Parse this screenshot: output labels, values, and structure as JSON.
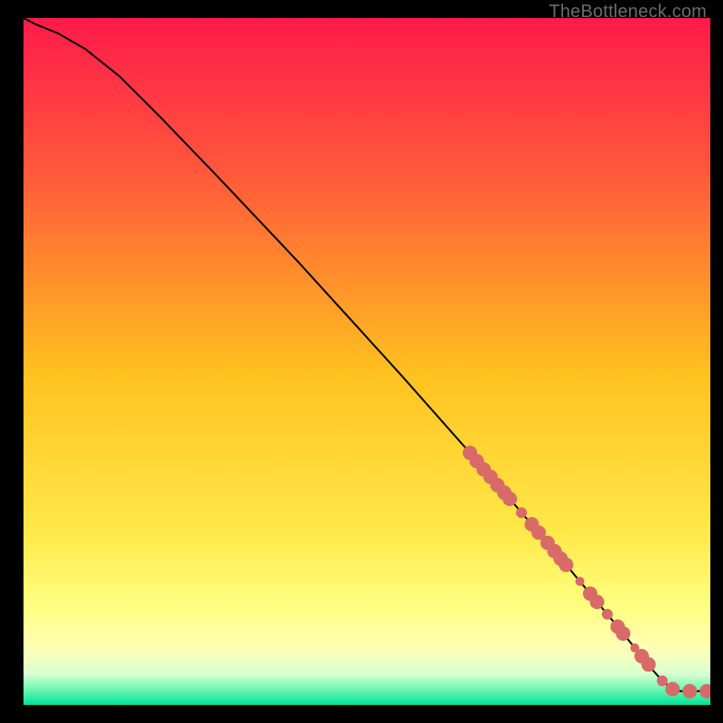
{
  "watermark": "TheBottleneck.com",
  "colors": {
    "background": "#000000",
    "curve": "#000000",
    "marker_fill": "#d86a68",
    "marker_stroke": "#b24c4c"
  },
  "chart_data": {
    "type": "line",
    "title": "",
    "xlabel": "",
    "ylabel": "",
    "xlim": [
      0,
      100
    ],
    "ylim": [
      0,
      100
    ],
    "grid": false,
    "legend": false,
    "gradient_stops": [
      {
        "offset": 0.0,
        "color": "#ff1a4b"
      },
      {
        "offset": 0.23,
        "color": "#ff5a3a"
      },
      {
        "offset": 0.52,
        "color": "#ffc21f"
      },
      {
        "offset": 0.75,
        "color": "#ffe94a"
      },
      {
        "offset": 0.86,
        "color": "#ffff83"
      },
      {
        "offset": 0.92,
        "color": "#fdffb7"
      },
      {
        "offset": 0.955,
        "color": "#d7ffd0"
      },
      {
        "offset": 0.975,
        "color": "#79f7b6"
      },
      {
        "offset": 1.0,
        "color": "#00e598"
      }
    ],
    "series": [
      {
        "name": "bottleneck-curve",
        "x": [
          0.0,
          2.0,
          5.0,
          9.0,
          14.0,
          20.0,
          28.0,
          40.0,
          55.0,
          65.0,
          72.0,
          78.0,
          82.0,
          86.0,
          89.0,
          91.5,
          93.2,
          95.0,
          97.5,
          100.0
        ],
        "y": [
          100.0,
          99.0,
          97.8,
          95.5,
          91.5,
          85.5,
          77.2,
          64.5,
          48.0,
          36.7,
          28.6,
          21.6,
          16.8,
          12.0,
          8.3,
          5.2,
          3.3,
          2.0,
          2.0,
          2.0
        ]
      }
    ],
    "markers": {
      "name": "highlight-points",
      "x": [
        65.0,
        66.0,
        67.0,
        68.0,
        69.0,
        70.0,
        70.8,
        72.5,
        74.0,
        75.0,
        76.3,
        77.3,
        78.2,
        79.0,
        81.0,
        82.5,
        83.5,
        85.0,
        86.5,
        87.3,
        89.0,
        90.0,
        91.0,
        93.0,
        94.5,
        97.0,
        99.5
      ],
      "y": [
        36.7,
        35.5,
        34.3,
        33.2,
        32.0,
        30.9,
        30.0,
        28.0,
        26.3,
        25.1,
        23.6,
        22.4,
        21.3,
        20.4,
        18.0,
        16.2,
        15.0,
        13.2,
        11.4,
        10.4,
        8.3,
        7.1,
        5.9,
        3.5,
        2.3,
        2.0,
        2.0
      ],
      "r": [
        8,
        8,
        8,
        8,
        8,
        8,
        8,
        6,
        8,
        8,
        8,
        8,
        8,
        8,
        5,
        8,
        8,
        6,
        8,
        8,
        5,
        8,
        8,
        6,
        8,
        8,
        8
      ]
    }
  }
}
